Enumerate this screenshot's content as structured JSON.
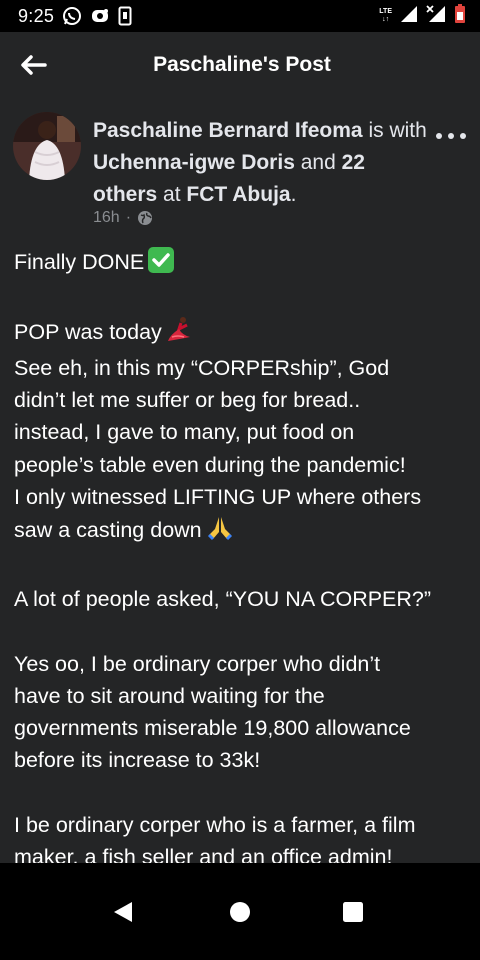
{
  "status": {
    "time": "9:25",
    "network": "LTE"
  },
  "header": {
    "title": "Paschaline's Post"
  },
  "post": {
    "author": "Paschaline Bernard Ifeoma",
    "with_text": " is with ",
    "tagged": "Uchenna-igwe Doris",
    "and_text": " and ",
    "others": "22 others",
    "at_text": " at ",
    "location": "FCT Abuja",
    "period": ".",
    "time": "16h",
    "dot": "·",
    "lines": [
      "Finally DONE",
      "",
      "POP was today",
      "See eh, in this my “CORPERship”, God",
      "didn’t let me suffer or beg for bread..",
      "instead, I gave to many, put food on",
      "people’s table even during the pandemic!",
      "I only witnessed LIFTING UP where others",
      "saw a casting down",
      "",
      "A lot of people asked, “YOU NA CORPER?”",
      "",
      "Yes oo, I be ordinary corper who didn’t",
      "have to sit around waiting for the",
      "governments miserable 19,800 allowance",
      "before its increase to 33k!",
      "",
      "I be ordinary corper who is a farmer, a film",
      "maker, a fish seller and an office admin!"
    ]
  },
  "icons": {
    "status_left": [
      "whatsapp-icon",
      "camera-notification-icon",
      "screenshot-icon"
    ],
    "status_right": [
      "lte-icon",
      "signal-icon",
      "signal-x-icon",
      "battery-icon"
    ],
    "emojis": [
      "check-mark-emoji",
      "dancer-emoji",
      "praying-hands-emoji"
    ],
    "nav": [
      "back-triangle-icon",
      "home-circle-icon",
      "recents-square-icon"
    ]
  },
  "colors": {
    "background": "#242526",
    "text": "#ffffff",
    "secondary_text": "#8a8d91",
    "check_green": "#3fb950",
    "battery": "#e0443d"
  }
}
